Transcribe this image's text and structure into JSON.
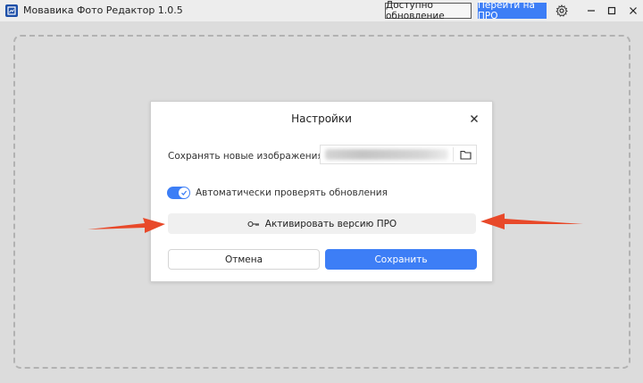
{
  "window": {
    "title": "Мовавика Фото Редактор 1.0.5",
    "update_label": "Доступно обновление",
    "pro_label": "Перейти на ПРО"
  },
  "icons": {
    "app": "app-logo-icon",
    "gear": "gear-icon",
    "minimize": "minimize-icon",
    "maximize": "maximize-icon",
    "close": "close-icon",
    "folder": "folder-icon",
    "key": "key-icon",
    "check": "check-icon",
    "arrow": "arrow-icon"
  },
  "dialog": {
    "title": "Настройки",
    "save_folder_label": "Сохранять новые изображения в папку:",
    "auto_update_label": "Автоматически проверять обновления",
    "auto_update_enabled": true,
    "activate_label": "Активировать версию ПРО",
    "cancel_label": "Отмена",
    "save_label": "Сохранить"
  },
  "colors": {
    "accent": "#3d7ef6",
    "arrow": "#e8492a",
    "background": "#dcdcdc"
  }
}
